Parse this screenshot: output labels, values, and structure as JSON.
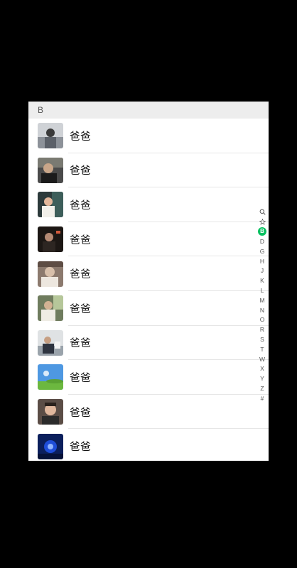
{
  "section": {
    "header_letter": "B"
  },
  "contacts": [
    {
      "name": "爸爸",
      "avatar": "avatar-photo-1"
    },
    {
      "name": "爸爸",
      "avatar": "avatar-photo-2"
    },
    {
      "name": "爸爸",
      "avatar": "avatar-photo-3"
    },
    {
      "name": "爸爸",
      "avatar": "avatar-photo-4"
    },
    {
      "name": "爸爸",
      "avatar": "avatar-photo-5"
    },
    {
      "name": "爸爸",
      "avatar": "avatar-photo-6"
    },
    {
      "name": "爸爸",
      "avatar": "avatar-photo-7"
    },
    {
      "name": "爸爸",
      "avatar": "avatar-photo-8"
    },
    {
      "name": "爸爸",
      "avatar": "avatar-photo-9"
    },
    {
      "name": "爸爸",
      "avatar": "avatar-photo-10"
    }
  ],
  "index_bar": {
    "search_icon": "search-icon",
    "star_icon": "star-icon",
    "letters": [
      "B",
      "D",
      "G",
      "H",
      "J",
      "K",
      "L",
      "M",
      "N",
      "O",
      "R",
      "S",
      "T",
      "W",
      "X",
      "Y",
      "Z",
      "#"
    ],
    "active_letter": "B"
  },
  "colors": {
    "background": "#000000",
    "list_background": "#ffffff",
    "section_header_bg": "#ededed",
    "active_index": "#07c160",
    "divider": "#e6e6e6"
  }
}
